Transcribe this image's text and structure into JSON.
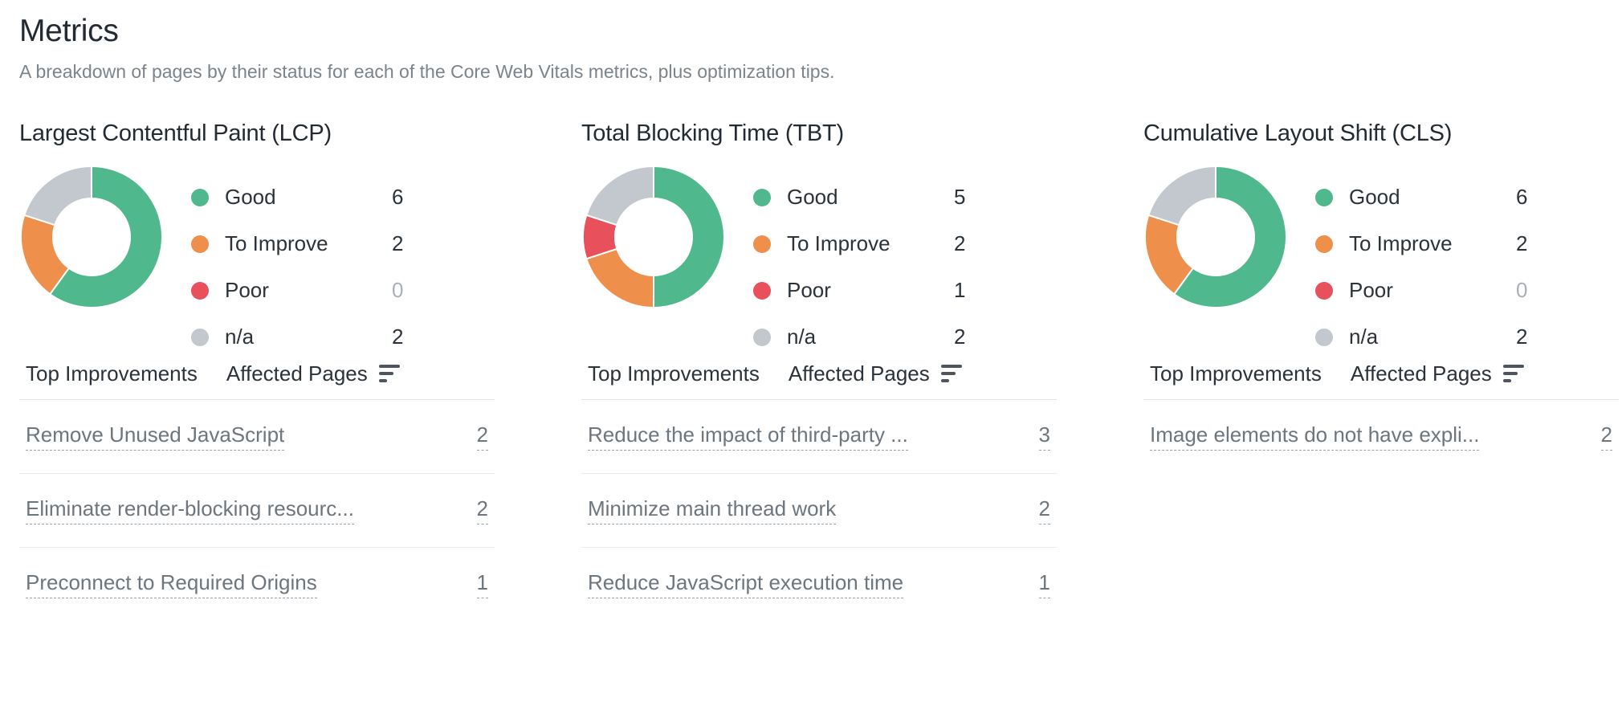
{
  "header": {
    "title": "Metrics",
    "subtitle": "A breakdown of pages by their status for each of the Core Web Vitals metrics, plus optimization tips."
  },
  "table_headers": {
    "improvements": "Top Improvements",
    "affected_pages": "Affected Pages",
    "sort_icon": "sort-descending-icon"
  },
  "colors": {
    "good": "#4fb98d",
    "to_improve": "#ee8f4b",
    "poor": "#e8505b",
    "na": "#c3c8ce"
  },
  "chart_data": [
    {
      "type": "pie",
      "title": "Largest Contentful Paint (LCP)",
      "categories": [
        "Good",
        "To Improve",
        "Poor",
        "n/a"
      ],
      "values": [
        6,
        2,
        0,
        2
      ],
      "colors": [
        "#4fb98d",
        "#ee8f4b",
        "#e8505b",
        "#c3c8ce"
      ],
      "legend_position": "right",
      "total": 10
    },
    {
      "type": "pie",
      "title": "Total Blocking Time (TBT)",
      "categories": [
        "Good",
        "To Improve",
        "Poor",
        "n/a"
      ],
      "values": [
        5,
        2,
        1,
        2
      ],
      "colors": [
        "#4fb98d",
        "#ee8f4b",
        "#e8505b",
        "#c3c8ce"
      ],
      "legend_position": "right",
      "total": 10
    },
    {
      "type": "pie",
      "title": "Cumulative Layout Shift (CLS)",
      "categories": [
        "Good",
        "To Improve",
        "Poor",
        "n/a"
      ],
      "values": [
        6,
        2,
        0,
        2
      ],
      "colors": [
        "#4fb98d",
        "#ee8f4b",
        "#e8505b",
        "#c3c8ce"
      ],
      "legend_position": "right",
      "total": 10
    }
  ],
  "metrics": [
    {
      "title": "Largest Contentful Paint (LCP)",
      "legend": [
        {
          "label": "Good",
          "value": "6",
          "color": "#4fb98d",
          "zero": false
        },
        {
          "label": "To Improve",
          "value": "2",
          "color": "#ee8f4b",
          "zero": false
        },
        {
          "label": "Poor",
          "value": "0",
          "color": "#e8505b",
          "zero": true
        },
        {
          "label": "n/a",
          "value": "2",
          "color": "#c3c8ce",
          "zero": false
        }
      ],
      "improvements": [
        {
          "name": "Remove Unused JavaScript",
          "count": "2"
        },
        {
          "name": "Eliminate render-blocking resourc...",
          "count": "2"
        },
        {
          "name": "Preconnect to Required Origins",
          "count": "1"
        }
      ]
    },
    {
      "title": "Total Blocking Time (TBT)",
      "legend": [
        {
          "label": "Good",
          "value": "5",
          "color": "#4fb98d",
          "zero": false
        },
        {
          "label": "To Improve",
          "value": "2",
          "color": "#ee8f4b",
          "zero": false
        },
        {
          "label": "Poor",
          "value": "1",
          "color": "#e8505b",
          "zero": false
        },
        {
          "label": "n/a",
          "value": "2",
          "color": "#c3c8ce",
          "zero": false
        }
      ],
      "improvements": [
        {
          "name": "Reduce the impact of third-party ...",
          "count": "3"
        },
        {
          "name": "Minimize main thread work",
          "count": "2"
        },
        {
          "name": "Reduce JavaScript execution time",
          "count": "1"
        }
      ]
    },
    {
      "title": "Cumulative Layout Shift (CLS)",
      "legend": [
        {
          "label": "Good",
          "value": "6",
          "color": "#4fb98d",
          "zero": false
        },
        {
          "label": "To Improve",
          "value": "2",
          "color": "#ee8f4b",
          "zero": false
        },
        {
          "label": "Poor",
          "value": "0",
          "color": "#e8505b",
          "zero": true
        },
        {
          "label": "n/a",
          "value": "2",
          "color": "#c3c8ce",
          "zero": false
        }
      ],
      "improvements": [
        {
          "name": "Image elements do not have expli...",
          "count": "2"
        }
      ]
    }
  ]
}
